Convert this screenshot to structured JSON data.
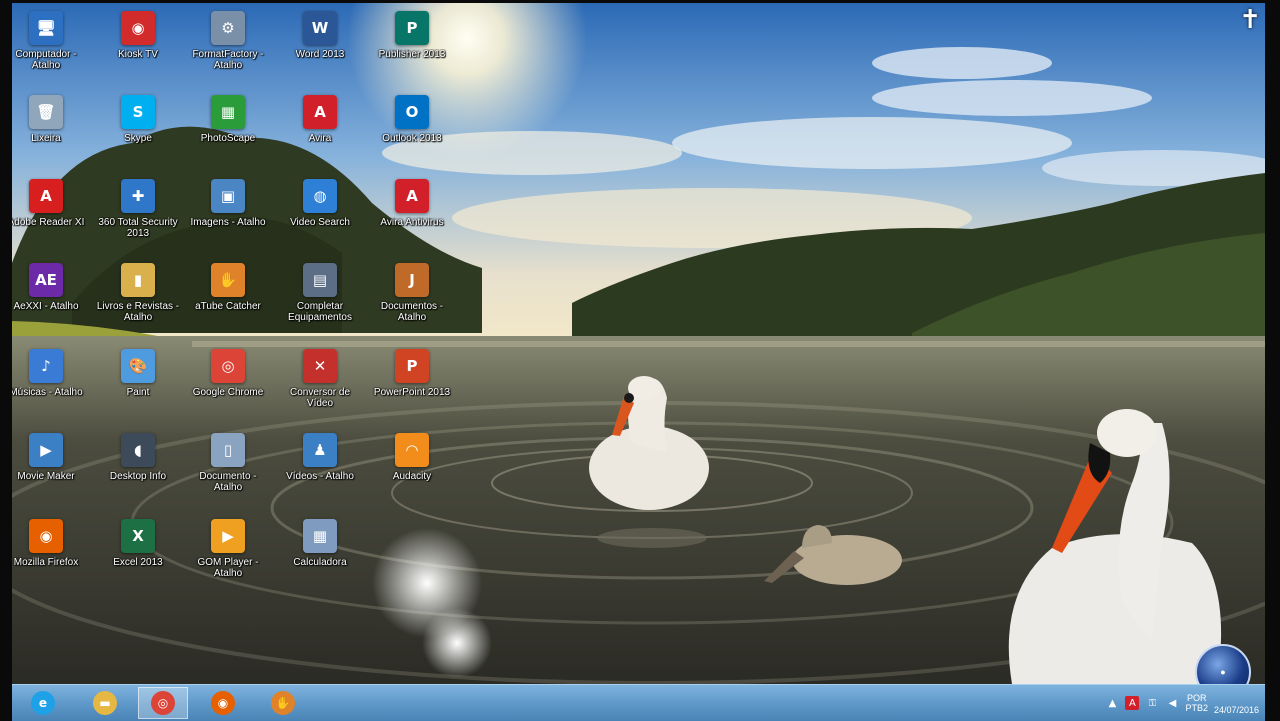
{
  "desktop": {
    "top_right_glyph": "✝",
    "icons": [
      {
        "id": "computador",
        "label": "Computador - Atalho",
        "glyph": "🖥",
        "color": "#2d6fc0"
      },
      {
        "id": "kiosk",
        "label": "Kiosk TV",
        "glyph": "◉",
        "color": "#d12b2b"
      },
      {
        "id": "format-factory",
        "label": "FormatFactory - Atalho",
        "glyph": "⚙",
        "color": "#7a8fa8"
      },
      {
        "id": "word-2013",
        "label": "Word 2013",
        "glyph": "W",
        "color": "#2b5797"
      },
      {
        "id": "publisher-2013",
        "label": "Publisher 2013",
        "glyph": "P",
        "color": "#077568"
      },
      {
        "id": "lixeira",
        "label": "Lixeira",
        "glyph": "🗑",
        "color": "#8fa6bb"
      },
      {
        "id": "skype",
        "label": "Skype",
        "glyph": "S",
        "color": "#00aff0"
      },
      {
        "id": "photoscape",
        "label": "PhotoScape",
        "glyph": "▦",
        "color": "#2a9d3a"
      },
      {
        "id": "avira",
        "label": "Avira",
        "glyph": "A",
        "color": "#d2202b"
      },
      {
        "id": "outlook-2013",
        "label": "Outlook 2013",
        "glyph": "O",
        "color": "#0072c6"
      },
      {
        "id": "adobe-reader",
        "label": "Adobe Reader XI",
        "glyph": "A",
        "color": "#d71f1f"
      },
      {
        "id": "360-total-security",
        "label": "360 Total Security 2013",
        "glyph": "✚",
        "color": "#2f77c9"
      },
      {
        "id": "imagens",
        "label": "Imagens - Atalho",
        "glyph": "▣",
        "color": "#4b86c4"
      },
      {
        "id": "video-search",
        "label": "Video Search",
        "glyph": "◍",
        "color": "#2e7fd6"
      },
      {
        "id": "avira-antivirus",
        "label": "Avira Antivirus",
        "glyph": "A",
        "color": "#d2202b"
      },
      {
        "id": "aexxi",
        "label": "AeXXI - Atalho",
        "glyph": "AE",
        "color": "#6d2aa8"
      },
      {
        "id": "livros-e-revistas",
        "label": "Livros e Revistas - Atalho",
        "glyph": "▮",
        "color": "#d9b04b"
      },
      {
        "id": "atube-catcher",
        "label": "aTube Catcher",
        "glyph": "✋",
        "color": "#e0822a"
      },
      {
        "id": "complete-equipamentos",
        "label": "Completar Equipamentos",
        "glyph": "▤",
        "color": "#5b6e86"
      },
      {
        "id": "documentos",
        "label": "Documentos - Atalho",
        "glyph": "J",
        "color": "#c06a2a"
      },
      {
        "id": "musicas",
        "label": "Músicas - Atalho",
        "glyph": "♪",
        "color": "#3a7bd5"
      },
      {
        "id": "paint",
        "label": "Paint",
        "glyph": "🎨",
        "color": "#4f9be0"
      },
      {
        "id": "google-chrome",
        "label": "Google Chrome",
        "glyph": "◎",
        "color": "#db4437"
      },
      {
        "id": "conversor",
        "label": "Conversor de Vídeo",
        "glyph": "✕",
        "color": "#c4302b"
      },
      {
        "id": "powerpoint-2013",
        "label": "PowerPoint 2013",
        "glyph": "P",
        "color": "#d04423"
      },
      {
        "id": "movie-maker",
        "label": "Movie Maker",
        "glyph": "▶",
        "color": "#3b7fc4"
      },
      {
        "id": "desktop-info",
        "label": "Desktop Info",
        "glyph": "◖",
        "color": "#3c4a5a"
      },
      {
        "id": "documento",
        "label": "Documento - Atalho",
        "glyph": "▯",
        "color": "#8aa3c0"
      },
      {
        "id": "videos",
        "label": "Vídeos - Atalho",
        "glyph": "♟",
        "color": "#3b7fc4"
      },
      {
        "id": "audacity",
        "label": "Audacity",
        "glyph": "◠",
        "color": "#f28c1b"
      },
      {
        "id": "mozilla-firefox",
        "label": "Mozilla Firefox",
        "glyph": "◉",
        "color": "#e66000"
      },
      {
        "id": "excel-2013",
        "label": "Excel 2013",
        "glyph": "X",
        "color": "#1d7044"
      },
      {
        "id": "gomplayer",
        "label": "GOM Player - Atalho",
        "glyph": "▶",
        "color": "#f0a020"
      },
      {
        "id": "calculadora",
        "label": "Calculadora",
        "glyph": "▦",
        "color": "#7f9cc0"
      }
    ]
  },
  "taskbar": {
    "items": [
      {
        "id": "internet-explorer",
        "glyph": "e",
        "color": "#1ea1e6"
      },
      {
        "id": "file-explorer",
        "glyph": "▬",
        "color": "#e6b843"
      },
      {
        "id": "chrome",
        "glyph": "◎",
        "color": "#db4437",
        "active": true
      },
      {
        "id": "firefox",
        "glyph": "◉",
        "color": "#e66000"
      },
      {
        "id": "atube",
        "glyph": "✋",
        "color": "#e0822a"
      }
    ],
    "tray": {
      "language_line1": "POR",
      "language_line2": "PTB2",
      "date": "24/07/2016"
    }
  }
}
